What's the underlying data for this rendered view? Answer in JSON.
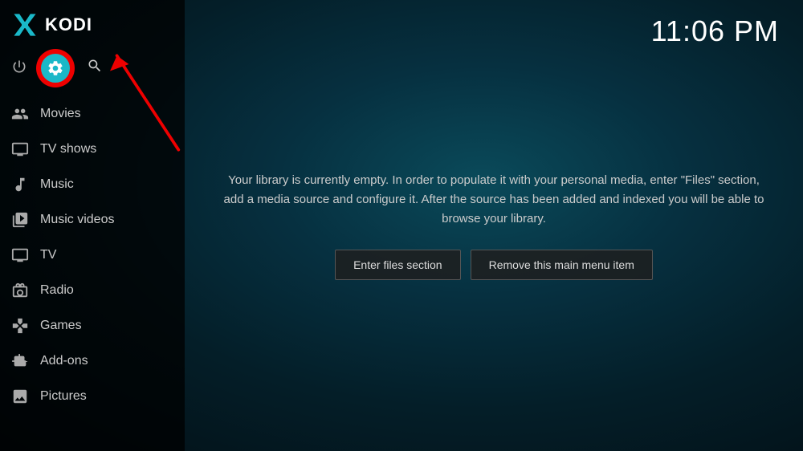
{
  "app": {
    "name": "KODI",
    "clock": "11:06 PM"
  },
  "sidebar": {
    "nav_items": [
      {
        "id": "movies",
        "label": "Movies",
        "icon": "movies"
      },
      {
        "id": "tv-shows",
        "label": "TV shows",
        "icon": "tv-shows"
      },
      {
        "id": "music",
        "label": "Music",
        "icon": "music"
      },
      {
        "id": "music-videos",
        "label": "Music videos",
        "icon": "music-videos"
      },
      {
        "id": "tv",
        "label": "TV",
        "icon": "tv"
      },
      {
        "id": "radio",
        "label": "Radio",
        "icon": "radio"
      },
      {
        "id": "games",
        "label": "Games",
        "icon": "games"
      },
      {
        "id": "add-ons",
        "label": "Add-ons",
        "icon": "add-ons"
      },
      {
        "id": "pictures",
        "label": "Pictures",
        "icon": "pictures"
      }
    ]
  },
  "main": {
    "library_message": "Your library is currently empty. In order to populate it with your personal media, enter \"Files\" section, add a media source and configure it. After the source has been added and indexed you will be able to browse your library.",
    "btn_enter_files": "Enter files section",
    "btn_remove_menu": "Remove this main menu item"
  }
}
